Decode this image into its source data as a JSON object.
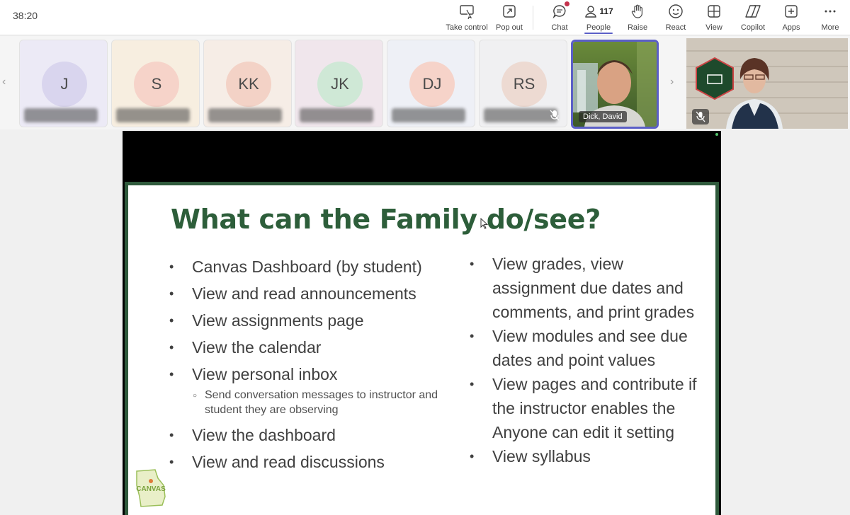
{
  "meeting": {
    "timer": "38:20",
    "toolbar": [
      {
        "id": "take-control",
        "label": "Take control",
        "icon": "take-control-icon"
      },
      {
        "id": "pop-out",
        "label": "Pop out",
        "icon": "pop-out-icon"
      },
      {
        "id": "chat",
        "label": "Chat",
        "icon": "chat-icon"
      },
      {
        "id": "people",
        "label": "People",
        "icon": "people-icon",
        "count": "117"
      },
      {
        "id": "raise",
        "label": "Raise",
        "icon": "raise-hand-icon"
      },
      {
        "id": "react",
        "label": "React",
        "icon": "react-icon"
      },
      {
        "id": "view",
        "label": "View",
        "icon": "view-icon"
      },
      {
        "id": "copilot",
        "label": "Copilot",
        "icon": "copilot-icon"
      },
      {
        "id": "apps",
        "label": "Apps",
        "icon": "apps-icon"
      },
      {
        "id": "more",
        "label": "More",
        "icon": "more-icon"
      }
    ]
  },
  "participants": [
    {
      "initials": "J",
      "bg": "#eceaf6",
      "avatar": "#d9d5ee"
    },
    {
      "initials": "S",
      "bg": "#f7eee0",
      "avatar": "#f6d3c9"
    },
    {
      "initials": "KK",
      "bg": "#f6ede6",
      "avatar": "#f3d2c6"
    },
    {
      "initials": "JK",
      "bg": "#f0e6ec",
      "avatar": "#cfe8d6"
    },
    {
      "initials": "DJ",
      "bg": "#eef0f6",
      "avatar": "#f6d3c9"
    },
    {
      "initials": "RS",
      "bg": "#f0f0f2",
      "avatar": "#eddad2"
    }
  ],
  "video_participant": {
    "name": "Dick, David"
  },
  "slide": {
    "title": "What can the Family do/see?",
    "left_bullets": [
      "Canvas Dashboard (by student)",
      "View and read announcements",
      "View assignments  page",
      "View the calendar",
      "View personal inbox"
    ],
    "sub_bullet": "Send conversation messages to instructor and student they are observing",
    "left_bullets_after": [
      "View the dashboard",
      "View and read discussions"
    ],
    "right_bullets": [
      "View grades, view assignment due dates and comments, and print grades",
      "View modules and see due dates and point values",
      "View pages and contribute if the instructor enables the Anyone can edit it setting",
      "View syllabus"
    ],
    "logo_text": "CANVAS"
  },
  "colors": {
    "slide_green": "#2d5e3a",
    "accent": "#5b5fc7"
  }
}
